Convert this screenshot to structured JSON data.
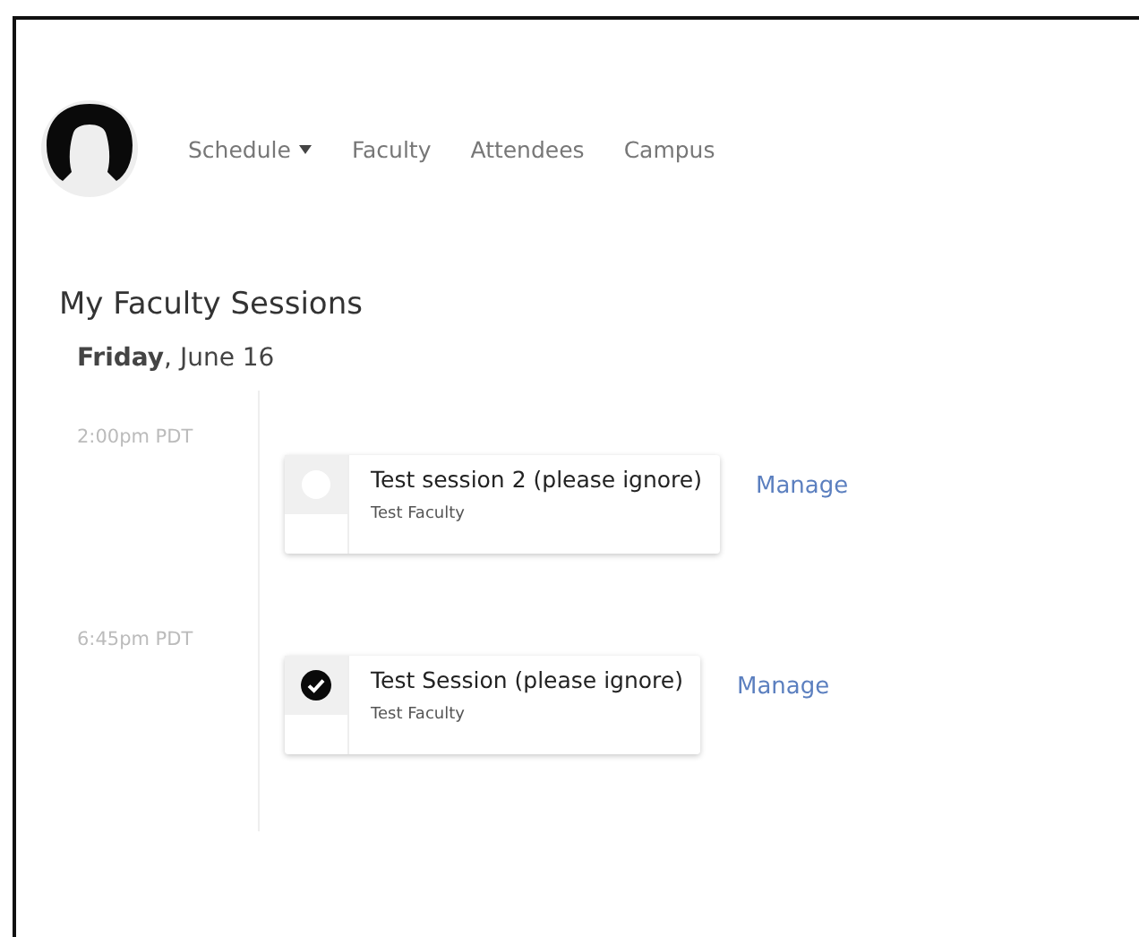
{
  "nav": {
    "items": [
      {
        "label": "Schedule",
        "has_menu": true
      },
      {
        "label": "Faculty",
        "has_menu": false
      },
      {
        "label": "Attendees",
        "has_menu": false
      },
      {
        "label": "Campus",
        "has_menu": false
      }
    ]
  },
  "page_title": "My Faculty Sessions",
  "date": "**Friday**, June 16",
  "sessions": [
    {
      "time": "2:00pm PDT",
      "title": "Test session 2 (please ignore)",
      "faculty": "Test Faculty",
      "checked": false,
      "action": "Manage"
    },
    {
      "time": "6:45pm PDT",
      "title": "Test Session (please ignore)",
      "faculty": "Test Faculty",
      "checked": true,
      "action": "Manage"
    }
  ]
}
